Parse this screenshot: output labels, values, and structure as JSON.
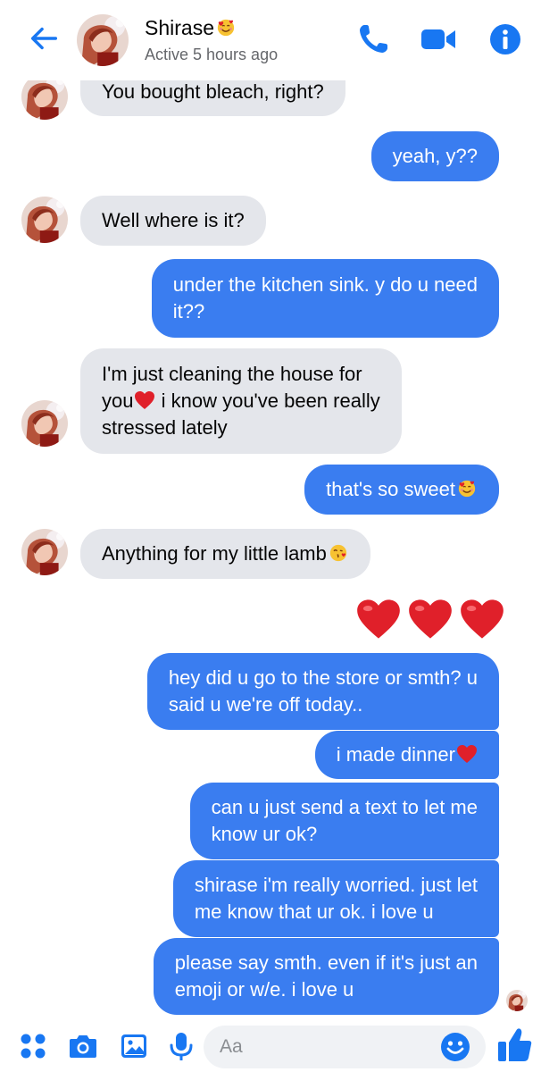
{
  "header": {
    "contact_name": "Shirase",
    "name_emoji": "smiling-face-with-hearts-icon",
    "status": "Active 5 hours ago",
    "back_icon": "arrow-left-icon",
    "call_icon": "phone-icon",
    "video_icon": "video-camera-icon",
    "info_icon": "info-icon"
  },
  "colors": {
    "accent": "#1877f2",
    "outgoing_bubble": "#3a7df0",
    "incoming_bubble": "#e4e6eb",
    "heart": "#e0202a"
  },
  "messages": [
    {
      "from": "them",
      "lines": [
        "You bought bleach, right?"
      ]
    },
    {
      "from": "me",
      "lines": [
        "yeah, y??"
      ]
    },
    {
      "from": "them",
      "lines": [
        "Well where is it?"
      ]
    },
    {
      "from": "me",
      "lines": [
        "under the kitchen sink. y do u need",
        "it??"
      ]
    },
    {
      "from": "them",
      "lines": [
        "I'm just cleaning the house for",
        "i know you've been really",
        "stressed lately"
      ],
      "line2_prefix": "you",
      "emoji": "red-heart-icon"
    },
    {
      "from": "me",
      "lines": [
        "that's so sweet"
      ],
      "emoji": "smiling-face-with-hearts-icon"
    },
    {
      "from": "them",
      "lines": [
        "Anything for my little lamb"
      ],
      "emoji": "face-blowing-kiss-icon"
    },
    {
      "from": "me",
      "type": "reaction",
      "emoji": "red-heart-icon",
      "count": 3
    },
    {
      "from": "me",
      "lines": [
        "hey did u go to the store or smth? u",
        "said u we're off today.."
      ]
    },
    {
      "from": "me",
      "lines": [
        "i made dinner"
      ],
      "emoji": "red-heart-icon"
    },
    {
      "from": "me",
      "lines": [
        "can u just send a text to let me",
        "know ur ok?"
      ]
    },
    {
      "from": "me",
      "lines": [
        "shirase i'm really worried. just let",
        "me know that ur ok. i love u"
      ]
    },
    {
      "from": "me",
      "lines": [
        "please say smth. even if it's just an",
        "emoji or w/e. i love u"
      ]
    }
  ],
  "composer": {
    "placeholder": "Aa",
    "icons": [
      "apps-icon",
      "camera-icon",
      "image-icon",
      "microphone-icon",
      "emoji-icon",
      "thumbs-up-icon"
    ]
  }
}
